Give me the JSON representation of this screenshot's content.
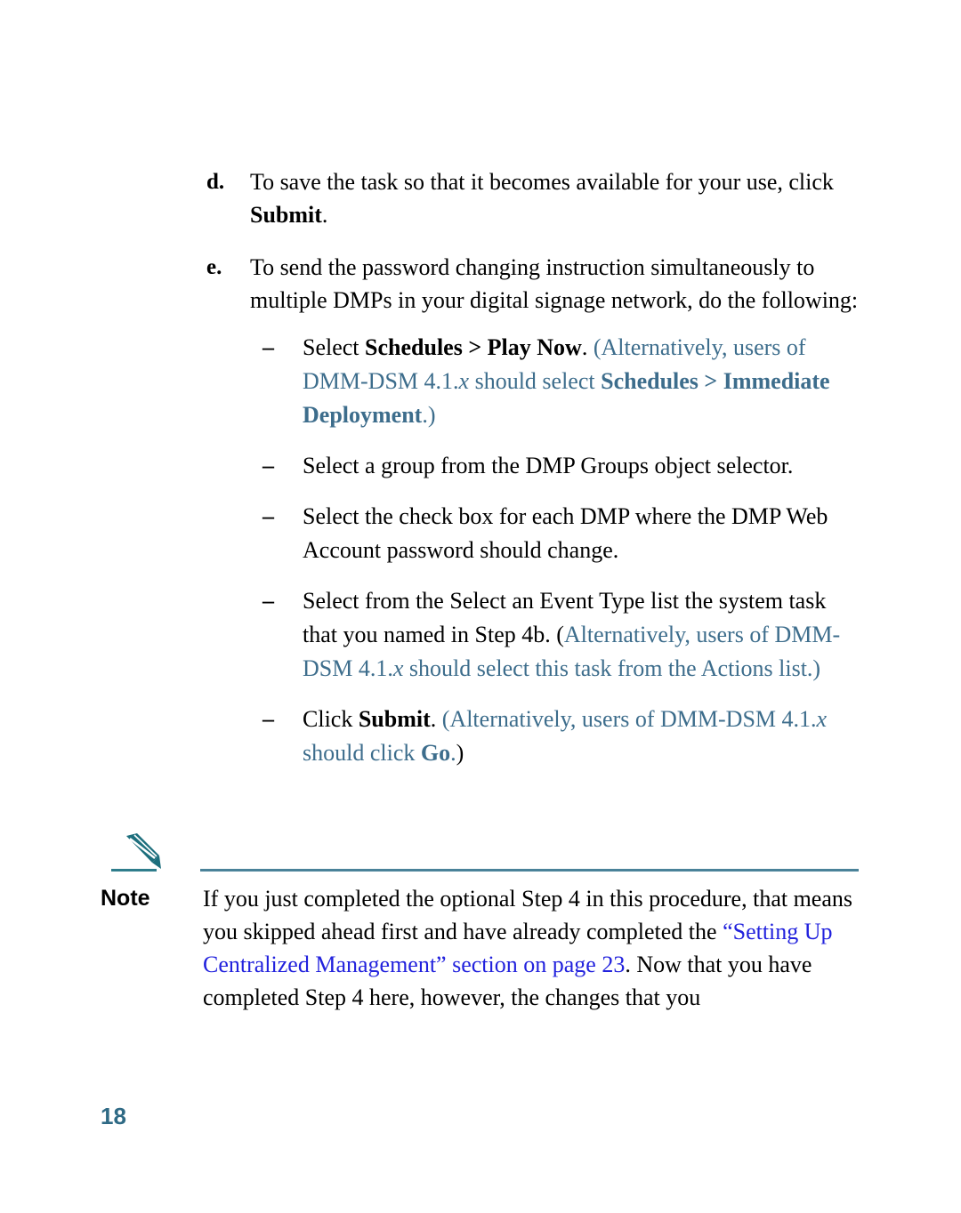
{
  "colors": {
    "body_text": "#000000",
    "muted_blue": "#3d6d8c",
    "link_blue": "#2222dd",
    "rule_teal": "#4a8299",
    "pencil_teal": "#1d6f7d",
    "folio_blue": "#2f6a85"
  },
  "steps": [
    {
      "marker": "d.",
      "text_before": "To save the task so that it becomes available for your use, click ",
      "bold": "Submit",
      "text_after": "."
    },
    {
      "marker": "e.",
      "text": "To send the password changing instruction simultaneously to multiple DMPs in your digital signage network, do the following:"
    }
  ],
  "sub_bullets": {
    "dash": "–",
    "items": [
      {
        "id": "select-schedules-play-now",
        "p1": "Select ",
        "p2_bold": "Schedules > Play Now",
        "p3": ". ",
        "p4_blue": "(Alternatively, users of DMM-DSM 4.1.",
        "p5_blue_italic": "x",
        "p6_blue": " should select ",
        "p7_blue_bold": "Schedules > Immediate Deployment",
        "p8_blue": ".)"
      },
      {
        "id": "select-group-dmp-groups",
        "p1": "Select a group from the DMP Groups object selector."
      },
      {
        "id": "select-check-box-each-dmp",
        "p1": "Select the check box for each DMP where the DMP Web Account password should change."
      },
      {
        "id": "select-event-type-list",
        "p1": "Select from the Select an Event Type list the system task that you named in Step 4b. (",
        "p4_blue": "Alternatively, users of DMM-DSM 4.1.",
        "p5_blue_italic": "x",
        "p6_blue": " should select this task from the Actions list.)"
      },
      {
        "id": "click-submit",
        "p1": "Click ",
        "p2_bold": "Submit",
        "p3": ". ",
        "p4_blue": "(Alternatively, users of DMM-DSM 4.1.",
        "p5_blue_italic": "x",
        "p6_blue": " should click ",
        "p7_blue_bold": "Go",
        "p8_blue": ".",
        "p9": ")"
      }
    ]
  },
  "note": {
    "icon": "pencil-icon",
    "label": "Note",
    "t1": "If you just completed the optional Step 4 in this procedure, that means you skipped ahead first and have already completed the ",
    "link": "“Setting Up Centralized Management” section on page 23",
    "t2": ". Now that you have completed Step 4 here, however, the changes that you"
  },
  "folio": {
    "page_number": "18"
  }
}
